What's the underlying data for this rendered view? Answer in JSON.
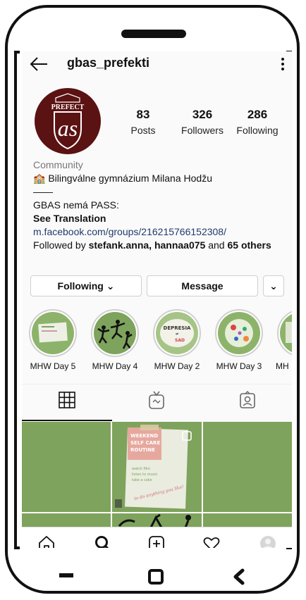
{
  "header": {
    "username": "gbas_prefekti"
  },
  "avatar": {
    "top_text": "PREFECT",
    "monogram": "as",
    "color": "#5b1212"
  },
  "stats": [
    {
      "count": "83",
      "label": "Posts"
    },
    {
      "count": "326",
      "label": "Followers"
    },
    {
      "count": "286",
      "label": "Following"
    }
  ],
  "bio": {
    "category": "Community",
    "line1": "🏫 Bilingválne gymnázium Milana Hodžu",
    "line2": "——",
    "line3": "GBAS nemá PASS:",
    "see_translation": "See Translation",
    "link": "m.facebook.com/groups/216215766152308/",
    "followed_prefix": "Followed by ",
    "followed_names": "stefank.anna, hannaa075",
    "followed_and": " and ",
    "followed_others": "65 others"
  },
  "actions": {
    "following": "Following ⌄",
    "message": "Message",
    "more": "⌄"
  },
  "highlights": [
    {
      "label": "MHW Day 5"
    },
    {
      "label": "MHW Day 4"
    },
    {
      "label": "MHW Day 2"
    },
    {
      "label": "MHW Day 3"
    },
    {
      "label": "MH"
    }
  ],
  "post_preview": {
    "title_1": "WEEKEND",
    "title_2": "SELF CARE",
    "title_3": "ROUTINE",
    "items": [
      "watch film",
      "listen to music",
      "take a cake"
    ],
    "tagline": "to do anything you like!",
    "highlight_depresia": "DEPRESIA",
    "highlight_sad": "SAD"
  },
  "colors": {
    "accent_green": "#7ea35c",
    "link_blue": "#1f3a6d",
    "brand_maroon": "#5b1212"
  },
  "icons": [
    "back-arrow-icon",
    "more-vertical-icon",
    "grid-icon",
    "igtv-icon",
    "tagged-icon",
    "home-icon",
    "search-icon",
    "new-post-icon",
    "activity-heart-icon",
    "profile-avatar-icon"
  ]
}
